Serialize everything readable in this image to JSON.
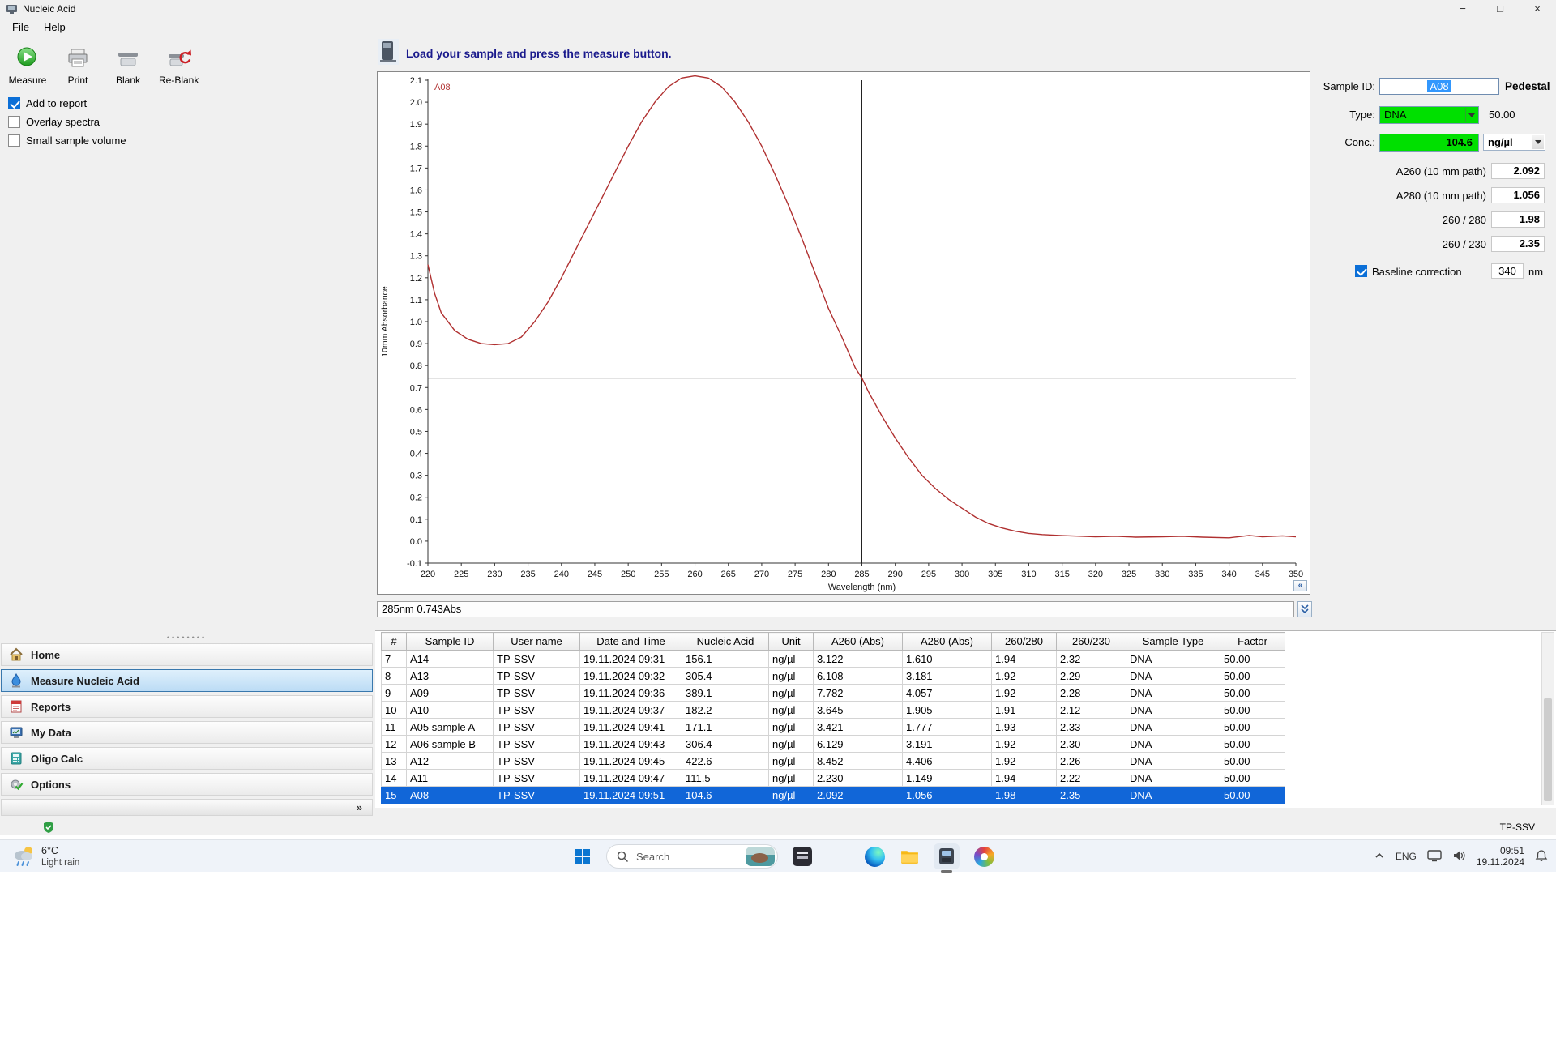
{
  "window": {
    "title": "Nucleic Acid",
    "menu": [
      {
        "label": "File"
      },
      {
        "label": "Help"
      }
    ],
    "controls": {
      "minimize": "−",
      "maximize": "□",
      "close": "×"
    }
  },
  "toolbar": {
    "buttons": [
      {
        "label": "Measure"
      },
      {
        "label": "Print"
      },
      {
        "label": "Blank"
      },
      {
        "label": "Re-Blank"
      }
    ],
    "checkboxes": [
      {
        "label": "Add to report",
        "checked": true
      },
      {
        "label": "Overlay spectra",
        "checked": false
      },
      {
        "label": "Small sample volume",
        "checked": false
      }
    ]
  },
  "nav": {
    "items": [
      {
        "label": "Home"
      },
      {
        "label": "Measure Nucleic Acid"
      },
      {
        "label": "Reports"
      },
      {
        "label": "My Data"
      },
      {
        "label": "Oligo Calc"
      },
      {
        "label": "Options"
      }
    ],
    "selected_index": 1,
    "expander_glyph": "»"
  },
  "main": {
    "instruction": "Load your sample and press the measure button.",
    "readout": "285nm 0.743Abs",
    "collapse_glyph": "«"
  },
  "chart_data": {
    "type": "line",
    "title": "",
    "xlabel": "Wavelength (nm)",
    "ylabel": "10mm Absorbance",
    "xlim": [
      220,
      350
    ],
    "ylim": [
      -0.1,
      2.1
    ],
    "xtick_step": 5,
    "ytick_step": 0.1,
    "grid": false,
    "crosshair": {
      "x": 285,
      "y": 0.743
    },
    "series": [
      {
        "name": "A08",
        "color": "#b03030",
        "points": [
          [
            220,
            1.26
          ],
          [
            221,
            1.13
          ],
          [
            222,
            1.04
          ],
          [
            224,
            0.96
          ],
          [
            226,
            0.92
          ],
          [
            228,
            0.9
          ],
          [
            230,
            0.895
          ],
          [
            232,
            0.9
          ],
          [
            234,
            0.93
          ],
          [
            236,
            1.0
          ],
          [
            238,
            1.09
          ],
          [
            240,
            1.2
          ],
          [
            242,
            1.32
          ],
          [
            244,
            1.44
          ],
          [
            246,
            1.56
          ],
          [
            248,
            1.68
          ],
          [
            250,
            1.8
          ],
          [
            252,
            1.91
          ],
          [
            254,
            2.0
          ],
          [
            256,
            2.07
          ],
          [
            258,
            2.11
          ],
          [
            260,
            2.12
          ],
          [
            262,
            2.11
          ],
          [
            264,
            2.07
          ],
          [
            266,
            2.0
          ],
          [
            268,
            1.91
          ],
          [
            270,
            1.8
          ],
          [
            272,
            1.67
          ],
          [
            274,
            1.53
          ],
          [
            276,
            1.38
          ],
          [
            278,
            1.22
          ],
          [
            280,
            1.06
          ],
          [
            282,
            0.93
          ],
          [
            284,
            0.79
          ],
          [
            285,
            0.743
          ],
          [
            286,
            0.68
          ],
          [
            288,
            0.57
          ],
          [
            290,
            0.47
          ],
          [
            292,
            0.38
          ],
          [
            294,
            0.3
          ],
          [
            296,
            0.24
          ],
          [
            298,
            0.19
          ],
          [
            300,
            0.15
          ],
          [
            302,
            0.11
          ],
          [
            304,
            0.08
          ],
          [
            306,
            0.06
          ],
          [
            308,
            0.045
          ],
          [
            310,
            0.035
          ],
          [
            312,
            0.03
          ],
          [
            315,
            0.025
          ],
          [
            318,
            0.022
          ],
          [
            320,
            0.02
          ],
          [
            323,
            0.022
          ],
          [
            326,
            0.018
          ],
          [
            330,
            0.02
          ],
          [
            333,
            0.022
          ],
          [
            336,
            0.018
          ],
          [
            340,
            0.015
          ],
          [
            343,
            0.026
          ],
          [
            345,
            0.02
          ],
          [
            348,
            0.024
          ],
          [
            350,
            0.02
          ]
        ]
      }
    ]
  },
  "side_panel": {
    "sample_id": {
      "label": "Sample ID:",
      "value": "A08",
      "mode": "Pedestal"
    },
    "type": {
      "label": "Type:",
      "value": "DNA",
      "factor": "50.00"
    },
    "conc": {
      "label": "Conc.:",
      "value": "104.6",
      "unit": "ng/µl"
    },
    "readings": [
      {
        "label": "A260 (10 mm path)",
        "value": "2.092"
      },
      {
        "label": "A280 (10 mm path)",
        "value": "1.056"
      },
      {
        "label": "260 / 280",
        "value": "1.98"
      },
      {
        "label": "260 / 230",
        "value": "2.35"
      }
    ],
    "baseline": {
      "label": "Baseline correction",
      "checked": true,
      "value": "340",
      "unit": "nm"
    }
  },
  "results_table": {
    "columns": [
      "#",
      "Sample ID",
      "User name",
      "Date and Time",
      "Nucleic Acid",
      "Unit",
      "A260 (Abs)",
      "A280 (Abs)",
      "260/280",
      "260/230",
      "Sample Type",
      "Factor"
    ],
    "rows": [
      [
        "7",
        "A14",
        "TP-SSV",
        "19.11.2024 09:31",
        "156.1",
        "ng/µl",
        "3.122",
        "1.610",
        "1.94",
        "2.32",
        "DNA",
        "50.00"
      ],
      [
        "8",
        "A13",
        "TP-SSV",
        "19.11.2024 09:32",
        "305.4",
        "ng/µl",
        "6.108",
        "3.181",
        "1.92",
        "2.29",
        "DNA",
        "50.00"
      ],
      [
        "9",
        "A09",
        "TP-SSV",
        "19.11.2024 09:36",
        "389.1",
        "ng/µl",
        "7.782",
        "4.057",
        "1.92",
        "2.28",
        "DNA",
        "50.00"
      ],
      [
        "10",
        "A10",
        "TP-SSV",
        "19.11.2024 09:37",
        "182.2",
        "ng/µl",
        "3.645",
        "1.905",
        "1.91",
        "2.12",
        "DNA",
        "50.00"
      ],
      [
        "11",
        "A05  sample A",
        "TP-SSV",
        "19.11.2024 09:41",
        "171.1",
        "ng/µl",
        "3.421",
        "1.777",
        "1.93",
        "2.33",
        "DNA",
        "50.00"
      ],
      [
        "12",
        "A06  sample B",
        "TP-SSV",
        "19.11.2024 09:43",
        "306.4",
        "ng/µl",
        "6.129",
        "3.191",
        "1.92",
        "2.30",
        "DNA",
        "50.00"
      ],
      [
        "13",
        "A12",
        "TP-SSV",
        "19.11.2024 09:45",
        "422.6",
        "ng/µl",
        "8.452",
        "4.406",
        "1.92",
        "2.26",
        "DNA",
        "50.00"
      ],
      [
        "14",
        "A11",
        "TP-SSV",
        "19.11.2024 09:47",
        "111.5",
        "ng/µl",
        "2.230",
        "1.149",
        "1.94",
        "2.22",
        "DNA",
        "50.00"
      ],
      [
        "15",
        "A08",
        "TP-SSV",
        "19.11.2024 09:51",
        "104.6",
        "ng/µl",
        "2.092",
        "1.056",
        "1.98",
        "2.35",
        "DNA",
        "50.00"
      ]
    ],
    "selected_index": 8
  },
  "status_bar": {
    "user": "TP-SSV"
  },
  "taskbar": {
    "weather": {
      "temp": "6°C",
      "condition": "Light rain"
    },
    "search": {
      "placeholder": "Search"
    },
    "tray": {
      "language": "ENG",
      "time": "09:51",
      "date": "19.11.2024"
    }
  }
}
